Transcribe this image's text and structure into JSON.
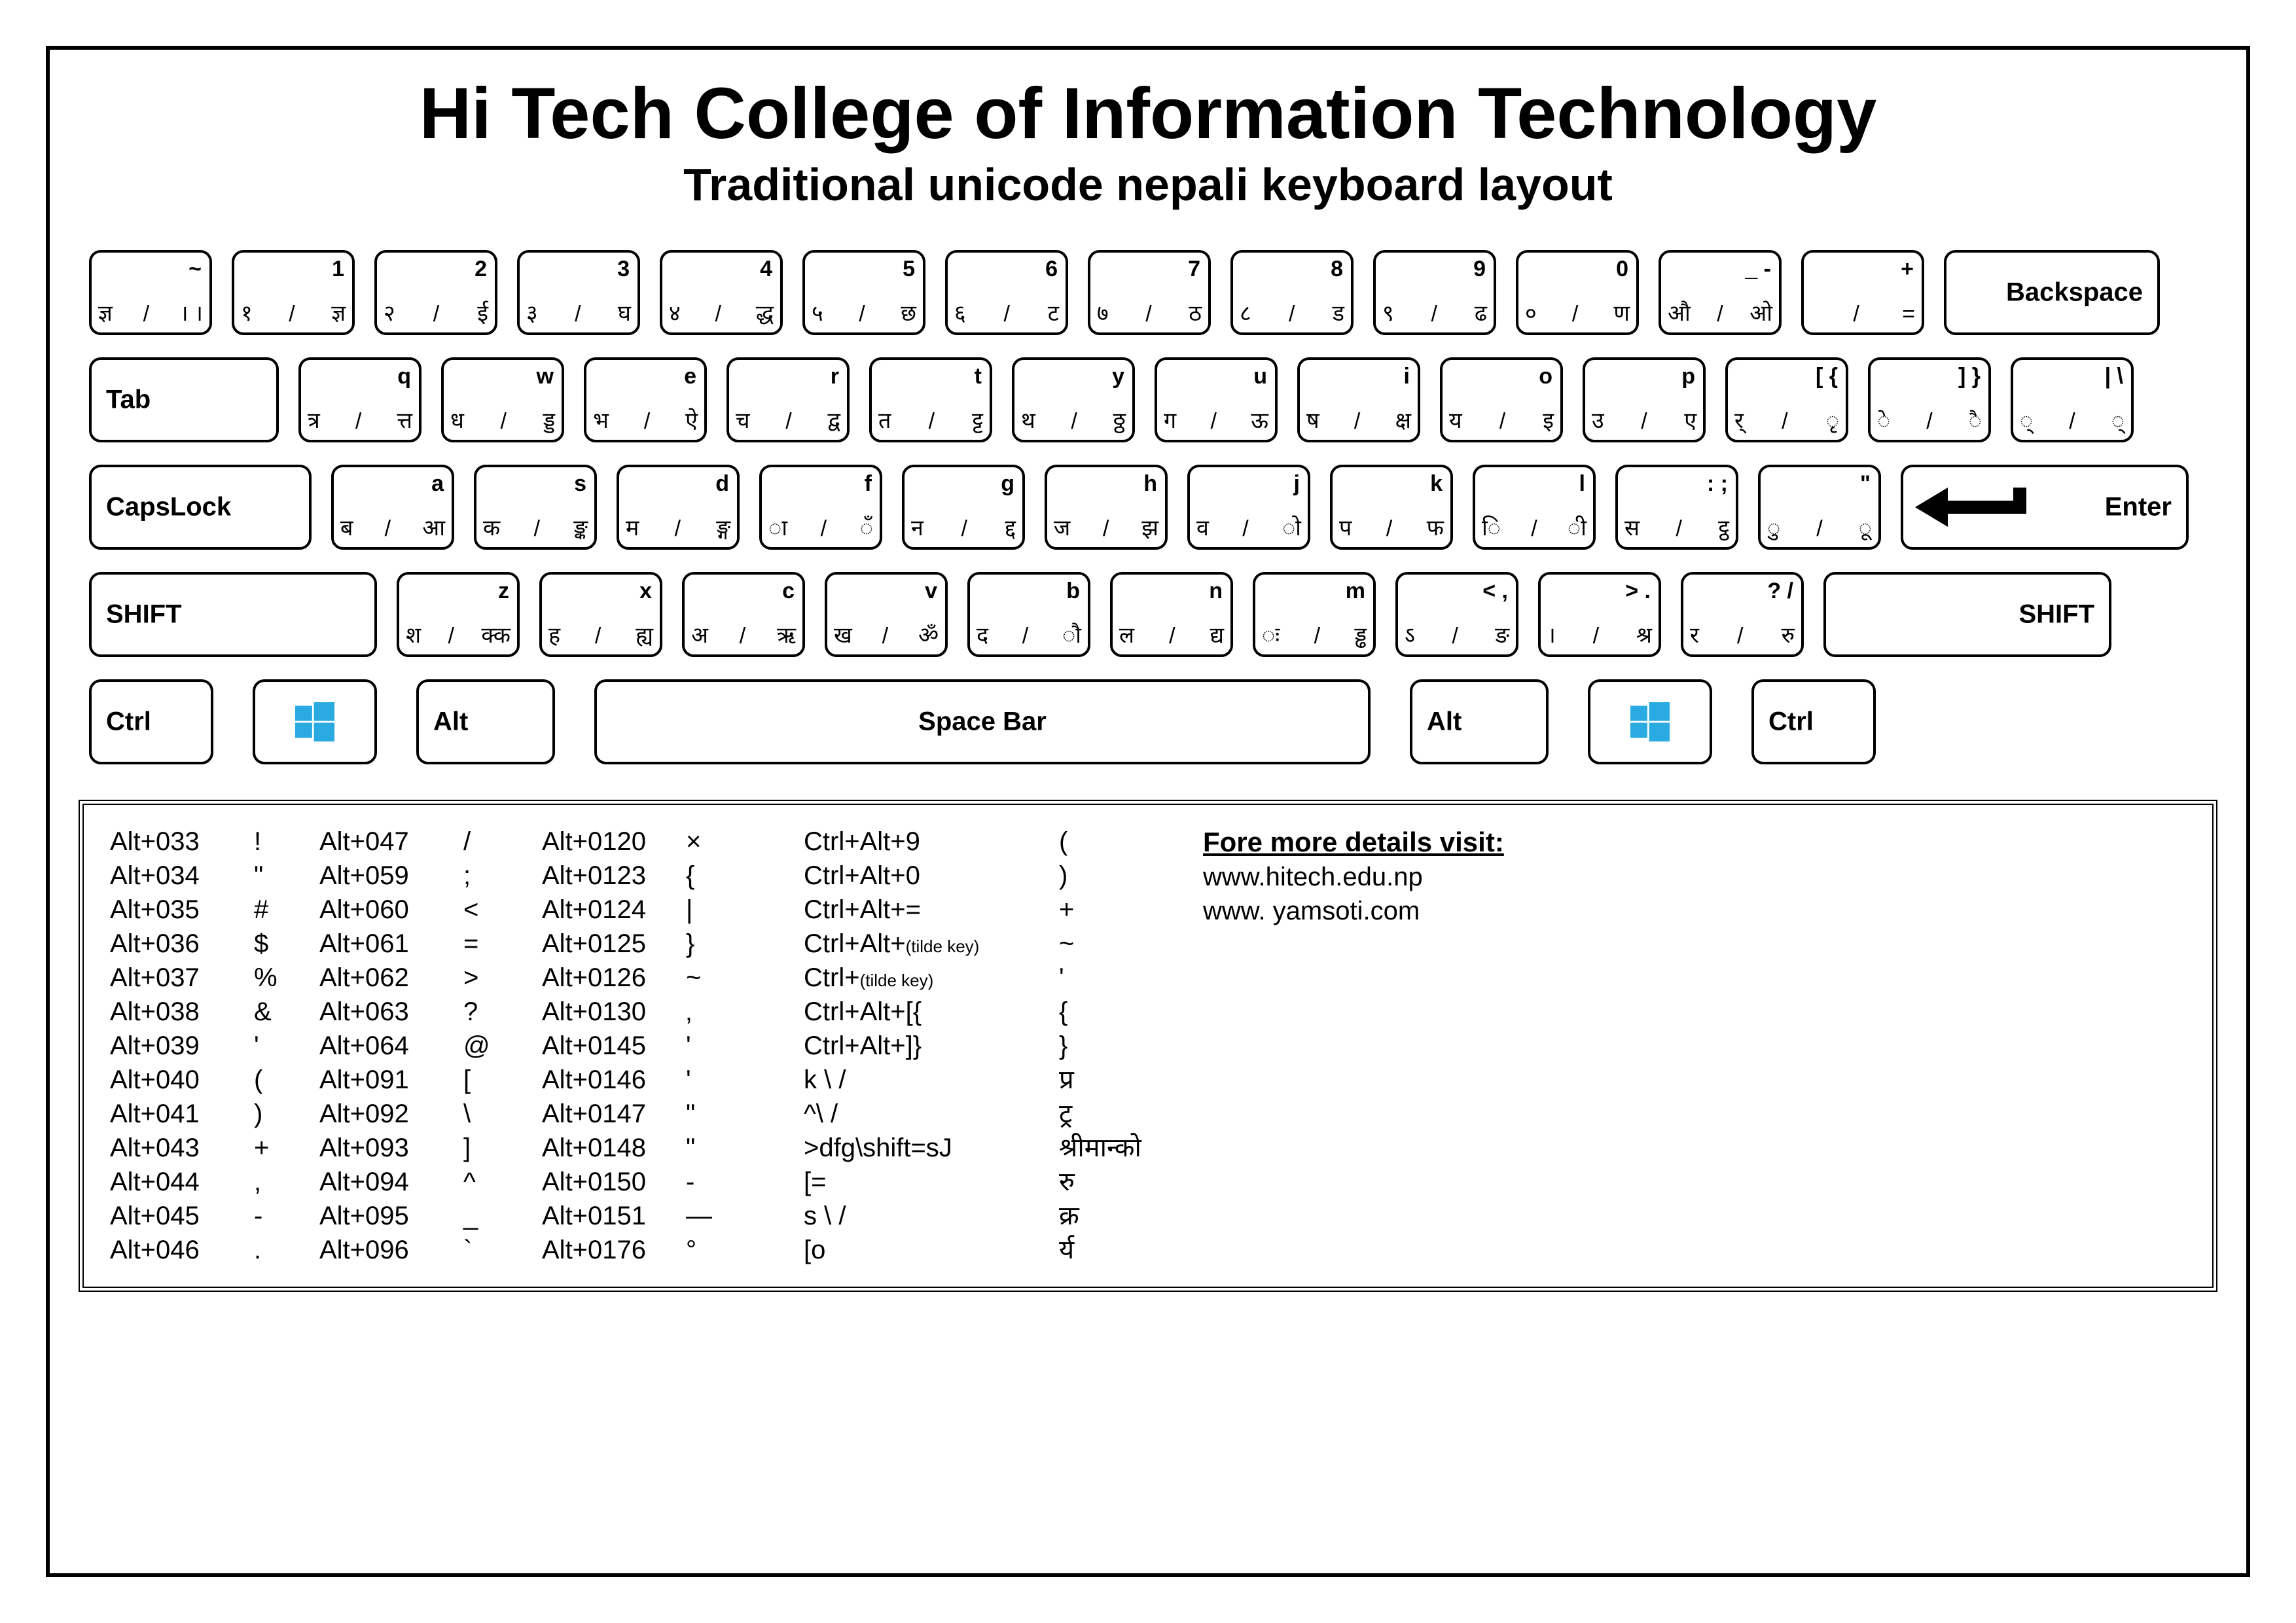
{
  "header": {
    "title": "Hi Tech College of Information Technology",
    "subtitle": "Traditional unicode nepali keyboard layout"
  },
  "rows": {
    "r1": [
      {
        "t": "~",
        "bl": "ज्ञ",
        "br": "। ।"
      },
      {
        "t": "1",
        "bl": "१",
        "br": "ज्ञ"
      },
      {
        "t": "2",
        "bl": "२",
        "br": "ई"
      },
      {
        "t": "3",
        "bl": "३",
        "br": "घ"
      },
      {
        "t": "4",
        "bl": "४",
        "br": "द्ध"
      },
      {
        "t": "5",
        "bl": "५",
        "br": "छ"
      },
      {
        "t": "6",
        "bl": "६",
        "br": "ट"
      },
      {
        "t": "7",
        "bl": "७",
        "br": "ठ"
      },
      {
        "t": "8",
        "bl": "८",
        "br": "ड"
      },
      {
        "t": "9",
        "bl": "९",
        "br": "ढ"
      },
      {
        "t": "0",
        "bl": "०",
        "br": "ण"
      },
      {
        "t": "_ -",
        "bl": "औ",
        "br": "ओ"
      },
      {
        "t": "+",
        "bl": "",
        "br": "="
      }
    ],
    "r1_backspace": "Backspace",
    "r2_tab": "Tab",
    "r2": [
      {
        "t": "q",
        "bl": "त्र",
        "br": "त्त"
      },
      {
        "t": "w",
        "bl": "ध",
        "br": "ड्ड"
      },
      {
        "t": "e",
        "bl": "भ",
        "br": "ऐ"
      },
      {
        "t": "r",
        "bl": "च",
        "br": "द्व"
      },
      {
        "t": "t",
        "bl": "त",
        "br": "ट्ट"
      },
      {
        "t": "y",
        "bl": "थ",
        "br": "ठ्ठ"
      },
      {
        "t": "u",
        "bl": "ग",
        "br": "ऊ"
      },
      {
        "t": "i",
        "bl": "ष",
        "br": "क्ष"
      },
      {
        "t": "o",
        "bl": "य",
        "br": "इ"
      },
      {
        "t": "p",
        "bl": "उ",
        "br": "ए"
      },
      {
        "t": "[ {",
        "bl": "र्",
        "br": "ृ"
      },
      {
        "t": "] }",
        "bl": "े",
        "br": "ै"
      },
      {
        "t": "| \\",
        "bl": "्",
        "br": "्"
      }
    ],
    "r3_caps": "CapsLock",
    "r3": [
      {
        "t": "a",
        "bl": "ब",
        "br": "आ"
      },
      {
        "t": "s",
        "bl": "क",
        "br": "ङ्क"
      },
      {
        "t": "d",
        "bl": "म",
        "br": "ङ्ग"
      },
      {
        "t": "f",
        "bl": "ा",
        "br": "ँ"
      },
      {
        "t": "g",
        "bl": "न",
        "br": "द्द"
      },
      {
        "t": "h",
        "bl": "ज",
        "br": "झ"
      },
      {
        "t": "j",
        "bl": "व",
        "br": "ो"
      },
      {
        "t": "k",
        "bl": "प",
        "br": "फ"
      },
      {
        "t": "l",
        "bl": "ि",
        "br": "ी"
      },
      {
        "t": ": ;",
        "bl": "स",
        "br": "ट्ठ"
      },
      {
        "t": "\"",
        "bl": "ु",
        "br": "ू"
      }
    ],
    "r3_enter": "Enter",
    "r4_shift": "SHIFT",
    "r4": [
      {
        "t": "z",
        "bl": "श",
        "br": "क्क"
      },
      {
        "t": "x",
        "bl": "ह",
        "br": "ह्य"
      },
      {
        "t": "c",
        "bl": "अ",
        "br": "ऋ"
      },
      {
        "t": "v",
        "bl": "ख",
        "br": "ॐ"
      },
      {
        "t": "b",
        "bl": "द",
        "br": "ौ"
      },
      {
        "t": "n",
        "bl": "ल",
        "br": "द्य"
      },
      {
        "t": "m",
        "bl": "ः",
        "br": "ड्ढ"
      },
      {
        "t": "< ,",
        "bl": "ऽ",
        "br": "ङ"
      },
      {
        "t": "> .",
        "bl": "।",
        "br": "श्र"
      },
      {
        "t": "? /",
        "bl": "र",
        "br": "रु"
      }
    ],
    "r5": {
      "ctrl": "Ctrl",
      "alt": "Alt",
      "space": "Space Bar"
    }
  },
  "alt_columns": {
    "c1": [
      [
        "Alt+033",
        "!"
      ],
      [
        "Alt+034",
        "\""
      ],
      [
        "Alt+035",
        "#"
      ],
      [
        "Alt+036",
        "$"
      ],
      [
        "Alt+037",
        "%"
      ],
      [
        "Alt+038",
        "&"
      ],
      [
        "Alt+039",
        "'"
      ],
      [
        "Alt+040",
        "("
      ],
      [
        "Alt+041",
        ")"
      ],
      [
        "Alt+043",
        "+"
      ],
      [
        "Alt+044",
        ","
      ],
      [
        "Alt+045",
        "-"
      ],
      [
        "Alt+046",
        "."
      ]
    ],
    "c2": [
      [
        "Alt+047",
        "/"
      ],
      [
        "Alt+059",
        ";"
      ],
      [
        "Alt+060",
        "<"
      ],
      [
        "Alt+061",
        "="
      ],
      [
        "Alt+062",
        ">"
      ],
      [
        "Alt+063",
        "?"
      ],
      [
        "Alt+064",
        "@"
      ],
      [
        "Alt+091",
        "["
      ],
      [
        "Alt+092",
        "\\"
      ],
      [
        "Alt+093",
        "]"
      ],
      [
        "Alt+094",
        "^"
      ],
      [
        "Alt+095",
        "_"
      ],
      [
        "Alt+096",
        "`"
      ]
    ],
    "c3": [
      [
        "Alt+0120",
        "×"
      ],
      [
        "Alt+0123",
        "{"
      ],
      [
        "Alt+0124",
        "|"
      ],
      [
        "Alt+0125",
        "}"
      ],
      [
        "Alt+0126",
        "~"
      ],
      [
        "Alt+0130",
        "‚"
      ],
      [
        "Alt+0145",
        "'"
      ],
      [
        "Alt+0146",
        "'"
      ],
      [
        "Alt+0147",
        "\""
      ],
      [
        "Alt+0148",
        "\""
      ],
      [
        "Alt+0150",
        "-"
      ],
      [
        "Alt+0151",
        "—"
      ],
      [
        "Alt+0176",
        "°"
      ]
    ],
    "c4": [
      [
        "Ctrl+Alt+9",
        "("
      ],
      [
        "Ctrl+Alt+0",
        ")"
      ],
      [
        "Ctrl+Alt+=",
        "+"
      ],
      [
        "Ctrl+Alt+(tilde key)",
        "~"
      ],
      [
        "Ctrl+(tilde key)",
        "'"
      ],
      [
        "Ctrl+Alt+[{",
        "{"
      ],
      [
        "Ctrl+Alt+]}",
        "}"
      ],
      [
        "k \\ /",
        "प्र"
      ],
      [
        "^\\ /",
        "ट्र"
      ],
      [
        ">dfg\\shift=sJ",
        "श्रीमान्को"
      ],
      [
        "[=",
        "रु"
      ],
      [
        "s \\ /",
        "क्र"
      ],
      [
        "[o",
        "र्य"
      ]
    ]
  },
  "more": {
    "title": "Fore more details visit:",
    "l1": "www.hitech.edu.np",
    "l2": "www. yamsoti.com"
  }
}
